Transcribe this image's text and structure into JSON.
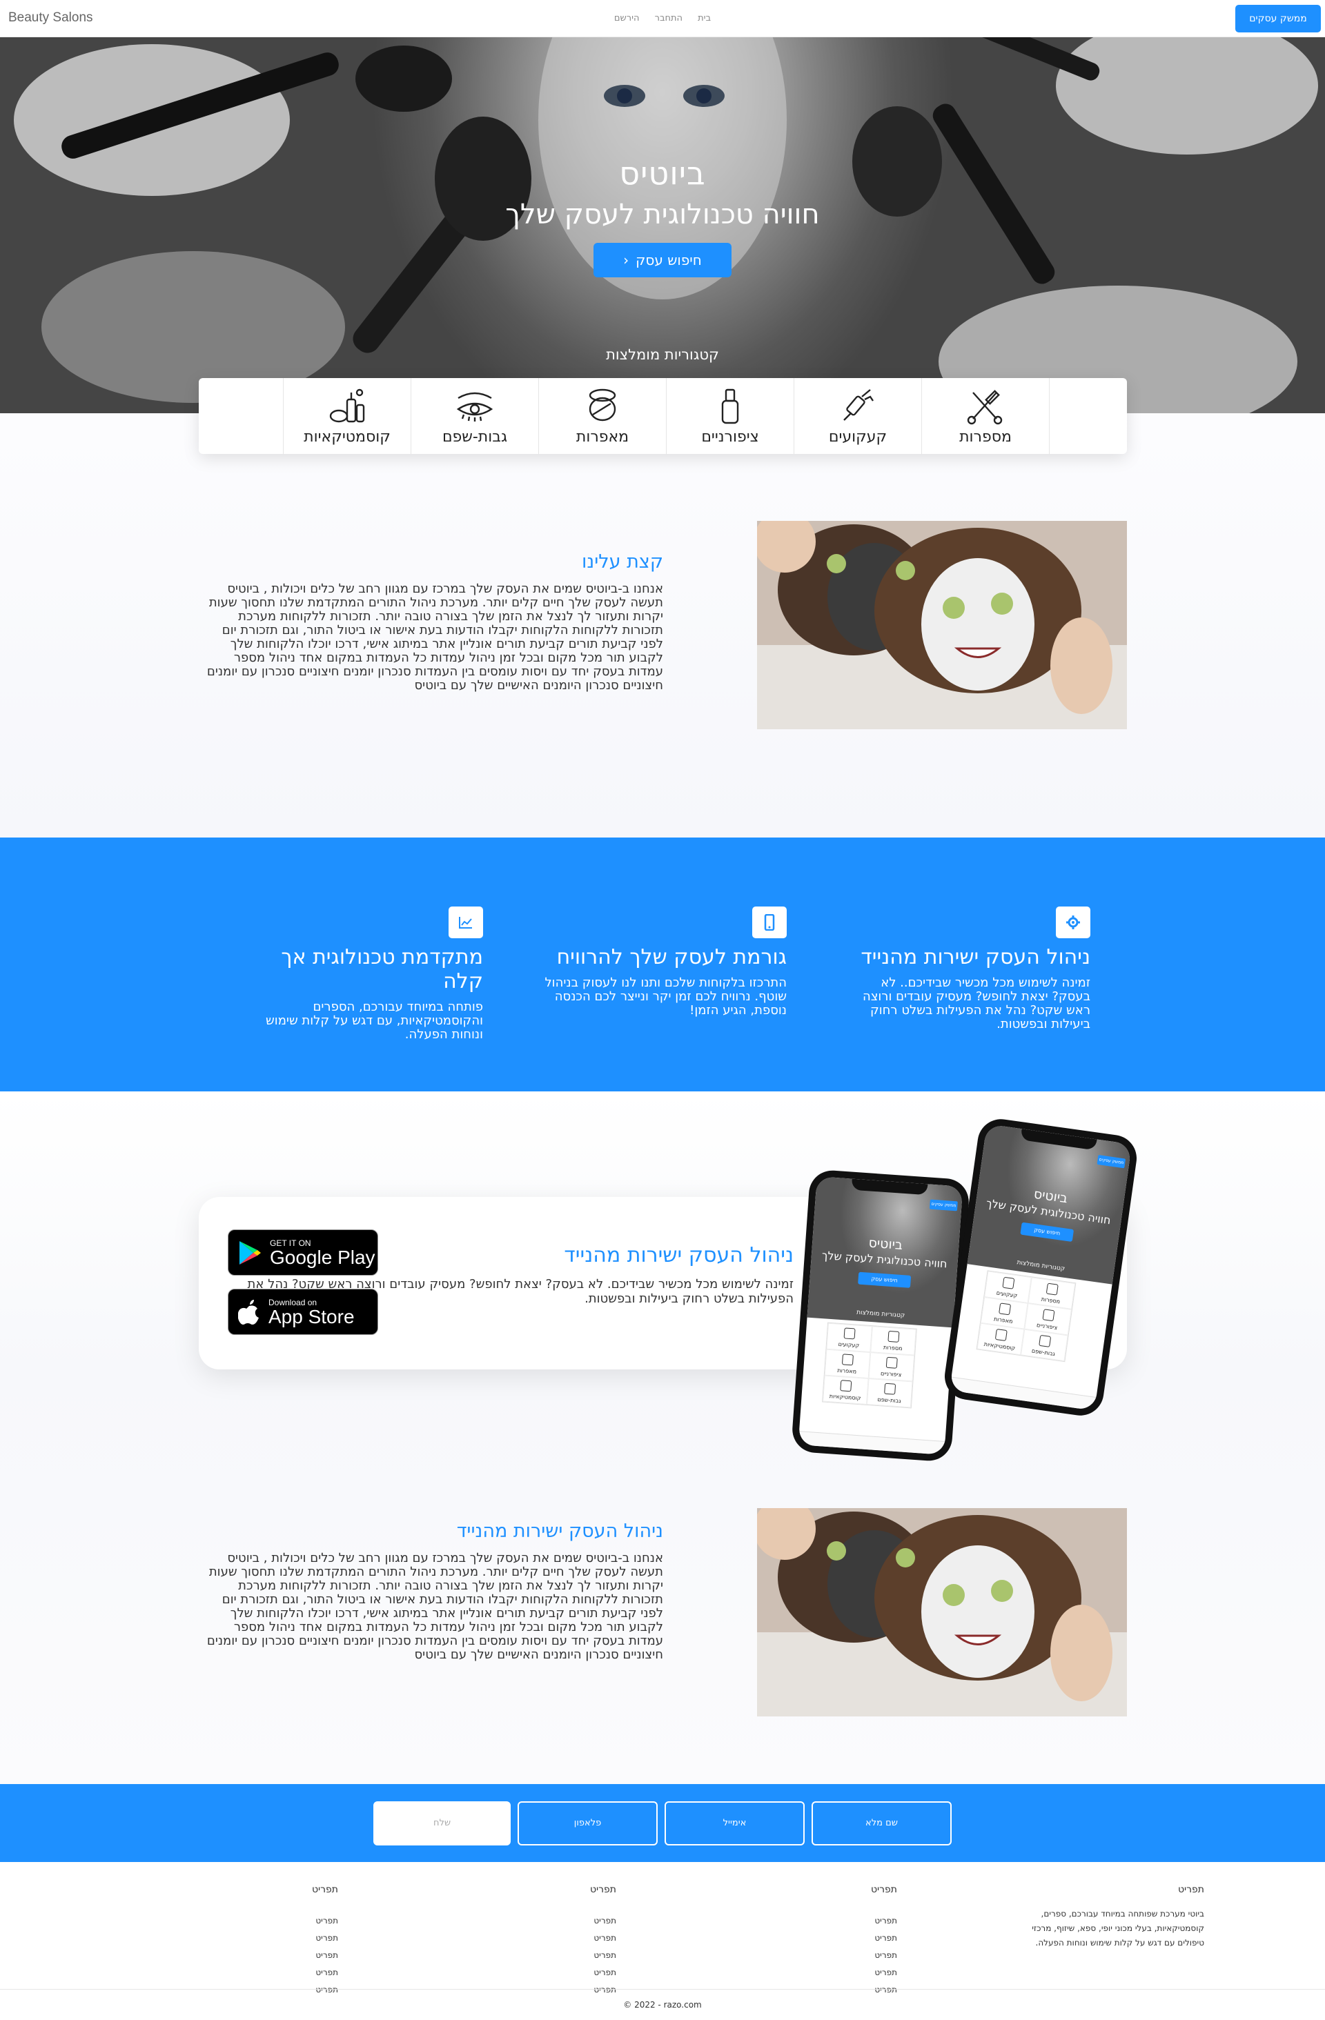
{
  "nav": {
    "brand": "Beauty Salons",
    "links": [
      "בית",
      "התחבר",
      "הירשם"
    ],
    "cta": "ממשק עסקים"
  },
  "hero": {
    "title": "ביוטיס",
    "subtitle": "חוויה טכנולוגית לעסק שלך",
    "button": "חיפוש עסק",
    "categories_title": "קטגוריות מומלצות"
  },
  "categories": [
    {
      "label": "מספרות",
      "icon": "scissors-comb-icon"
    },
    {
      "label": "קעקועים",
      "icon": "tattoo-machine-icon"
    },
    {
      "label": "ציפורניים",
      "icon": "nail-polish-icon"
    },
    {
      "label": "מאפרות",
      "icon": "makeup-compact-icon"
    },
    {
      "label": "גבות-שפם",
      "icon": "eyebrow-eye-icon"
    },
    {
      "label": "קוסמטיקאיות",
      "icon": "cosmetics-bottles-icon"
    }
  ],
  "about": {
    "title": "קצת עלינו",
    "body": "אנחנו ב-ביוטיס שמים את העסק שלך במרכז עם מגוון רחב של כלים ויכולות , ביוטיס תעשה לעסק שלך חיים קלים יותר. מערכת ניהול התורים המתקדמת שלנו תחסוך שעות יקרות ותעזור לך לנצל את הזמן שלך בצורה טובה יותר. תזכורות ללקוחות מערכת תזכורות ללקוחות הלקוחות יקבלו הודעות בעת אישור או ביטול התור, וגם תזכורת יום לפני קביעת תורים קביעת תורים אונליין אתר במיתוג אישי, דרכו יוכלו הלקוחות שלך לקבוע תור מכל מקום ובכל זמן ניהול עמדות כל העמדות במקום אחד ניהול מספר עמדות בעסק יחד עם ויסות עומסים בין העמדות סנכרון יומנים חיצוניים סנכרון עם יומנים חיצוניים סנכרון היומנים האישיים שלך עם ביוטיס"
  },
  "features": [
    {
      "title": "ניהול העסק ישירות מהנייד",
      "body": "זמינה לשימוש מכל מכשיר שבידיכם.. לא בעסק? יצאת לחופש? מעסיק עובדים ורוצה ראש שקט? נהל את הפעילות בשלט רחוק ביעילות ובפשטות.",
      "icon": "gear-icon"
    },
    {
      "title": "גורמת לעסק שלך להרוויח",
      "body": "התרכזו בלקוחות שלכם ותנו לנו לעסוק בניהול שוטף. נרוויח לכם זמן יקר ונייצר לכם הכנסה נוספת, הגיע הזמן!",
      "icon": "mobile-phone-icon"
    },
    {
      "title": "מתקדמת טכנולוגית אך קלה",
      "body": "פותחה במיוחד עבורכם, הספרים והקוסמטיקאיות, עם דגש על קלות שימוש ונוחות הפעלה.",
      "icon": "chart-icon"
    }
  ],
  "app_card": {
    "title": "ניהול העסק ישירות מהנייד",
    "body": "זמינה לשימוש מכל מכשיר שבידיכם. לא בעסק? יצאת לחופש? מעסיק עובדים ורוצה ראש שקט? נהל את הפעילות בשלט רחוק ביעילות ובפשטות.",
    "google_play_small": "GET IT ON",
    "google_play_big": "Google Play",
    "app_store_small": "Download on",
    "app_store_big": "App Store"
  },
  "phone_mock": {
    "title": "ביוטיס",
    "subtitle": "חוויה טכנולוגית לעסק שלך",
    "button": "חיפוש עסק",
    "categories_title": "קטגוריות מומלצות",
    "cta": "ממשק עסקים",
    "grid": [
      "מספרות",
      "קעקועים",
      "ציפורניים",
      "מאפרות",
      "גבות-שפם",
      "קוסמטיקאיות"
    ]
  },
  "about2": {
    "title": "ניהול העסק ישירות מהנייד",
    "body": "אנחנו ב-ביוטיס שמים את העסק שלך במרכז עם מגוון רחב של כלים ויכולות , ביוטיס תעשה לעסק שלך חיים קלים יותר. מערכת ניהול התורים המתקדמת שלנו תחסוך שעות יקרות ותעזור לך לנצל את הזמן שלך בצורה טובה יותר. תזכורות ללקוחות מערכת תזכורות ללקוחות הלקוחות יקבלו הודעות בעת אישור או ביטול התור, וגם תזכורת יום לפני קביעת תורים קביעת תורים אונליין אתר במיתוג אישי, דרכו יוכלו הלקוחות שלך לקבוע תור מכל מקום ובכל זמן ניהול עמדות כל העמדות במקום אחד ניהול מספר עמדות בעסק יחד עם ויסות עומסים בין העמדות סנכרון יומנים חיצוניים סנכרון עם יומנים חיצוניים סנכרון היומנים האישיים שלך עם ביוטיס"
  },
  "contact": {
    "name_placeholder": "שם מלא",
    "email_placeholder": "אימייל",
    "phone_placeholder": "פלאפון",
    "send": "שלח"
  },
  "footer": {
    "about_title": "תפריט",
    "about_text": "ביוטי מערכת שפותחה במיוחד עבורכם, ספרים, קוסמטיקאיות, בעלי מכוני יופי, ספא, שיזוף, מרכזי טיפולים עם דגש על קלות שימוש ונוחות הפעלה.",
    "columns": [
      {
        "title": "תפריט",
        "links": [
          "תפריט",
          "תפריט",
          "תפריט",
          "תפריט",
          "תפריט"
        ]
      },
      {
        "title": "תפריט",
        "links": [
          "תפריט",
          "תפריט",
          "תפריט",
          "תפריט",
          "תפריט"
        ]
      },
      {
        "title": "תפריט",
        "links": [
          "תפריט",
          "תפריט",
          "תפריט",
          "תפריט",
          "תפריט"
        ]
      }
    ],
    "copyright": "© 2022 - razo.com"
  },
  "colors": {
    "accent": "#1e90ff",
    "text": "#333333"
  }
}
